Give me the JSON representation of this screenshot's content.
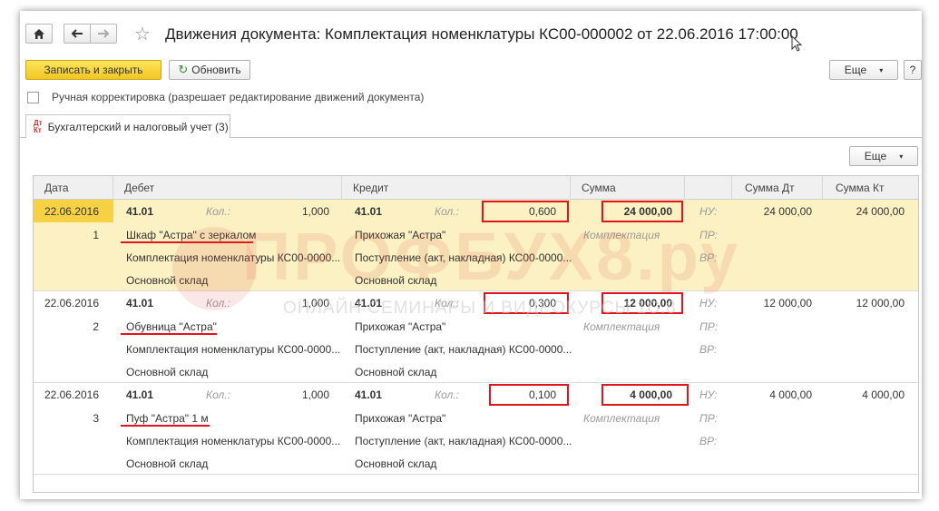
{
  "window": {
    "title": "Движения документа: Комплектация номенклатуры КС00-000002 от 22.06.2016 17:00:00"
  },
  "toolbar": {
    "save_close_label": "Записать и закрыть",
    "refresh_label": "Обновить",
    "more_label": "Еще",
    "help_label": "?"
  },
  "manual_edit": {
    "label": "Ручная корректировка (разрешает редактирование движений документа)",
    "checked": false
  },
  "tabs": [
    {
      "label": "Бухгалтерский и налоговый учет (3)",
      "active": true
    }
  ],
  "table": {
    "more_label": "Еще",
    "columns": [
      "Дата",
      "Дебет",
      "Кредит",
      "Сумма",
      "",
      "Сумма Дт",
      "Сумма Кт"
    ],
    "qty_label": "Кол.:",
    "labels": {
      "nu": "НУ:",
      "pr": "ПР:",
      "vr": "ВР:"
    },
    "rows": [
      {
        "date": "22.06.2016",
        "num": "1",
        "debit_account": "41.01",
        "debit_qty": "1,000",
        "debit_item": "Шкаф \"Астра\" с зеркалом",
        "debit_doc": "Комплектация номенклатуры КС00-0000...",
        "debit_warehouse": "Основной склад",
        "credit_account": "41.01",
        "credit_qty": "0,600",
        "credit_item": "Прихожая \"Астра\"",
        "credit_doc": "Поступление (акт, накладная) КС00-0000...",
        "credit_warehouse": "Основной склад",
        "amount": "24 000,00",
        "content": "Комплектация",
        "sum_dt": "24 000,00",
        "sum_kt": "24 000,00",
        "selected": true
      },
      {
        "date": "22.06.2016",
        "num": "2",
        "debit_account": "41.01",
        "debit_qty": "1,000",
        "debit_item": "Обувница \"Астра\"",
        "debit_doc": "Комплектация номенклатуры КС00-0000...",
        "debit_warehouse": "Основной склад",
        "credit_account": "41.01",
        "credit_qty": "0,300",
        "credit_item": "Прихожая \"Астра\"",
        "credit_doc": "Поступление (акт, накладная) КС00-0000...",
        "credit_warehouse": "Основной склад",
        "amount": "12 000,00",
        "content": "Комплектация",
        "sum_dt": "12 000,00",
        "sum_kt": "12 000,00",
        "selected": false
      },
      {
        "date": "22.06.2016",
        "num": "3",
        "debit_account": "41.01",
        "debit_qty": "1,000",
        "debit_item": "Пуф \"Астра\" 1 м",
        "debit_doc": "Комплектация номенклатуры КС00-0000...",
        "debit_warehouse": "Основной склад",
        "credit_account": "41.01",
        "credit_qty": "0,100",
        "credit_item": "Прихожая \"Астра\"",
        "credit_doc": "Поступление (акт, накладная) КС00-0000...",
        "credit_warehouse": "Основной склад",
        "amount": "4 000,00",
        "content": "Комплектация",
        "sum_dt": "4 000,00",
        "sum_kt": "4 000,00",
        "selected": false
      }
    ]
  },
  "watermark": {
    "brand": "ПРОФБУХ8.ру",
    "tagline": "ОНЛАЙН СЕМИНАРЫ И ВИДЕОКУРСЫ 1С:8"
  },
  "colors": {
    "primary_button": "#f4d03a",
    "selected_row": "#fbf1c2",
    "selected_date": "#f6d143",
    "highlight_red": "#e0151d"
  }
}
